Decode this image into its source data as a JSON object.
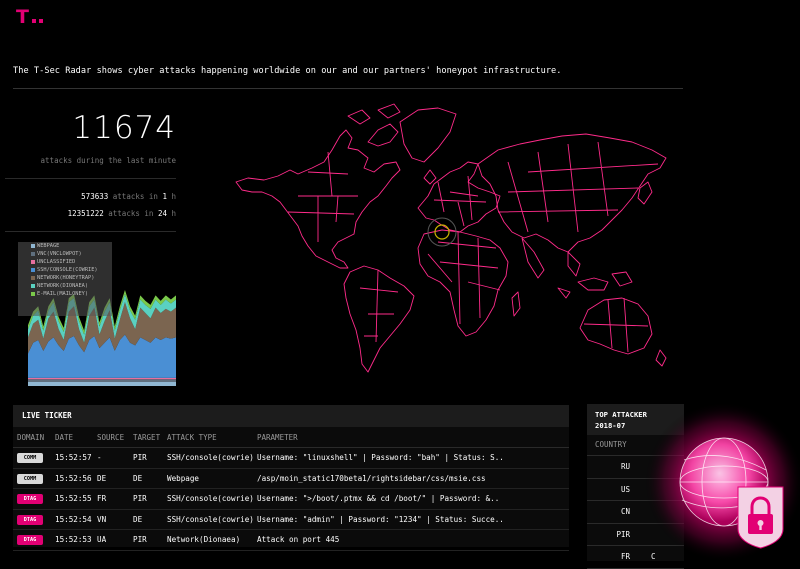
{
  "brand": {
    "logo_letter": "T",
    "color": "#e20074"
  },
  "intro_text": "The T-Sec Radar shows cyber attacks happening worldwide on our and our partners' honeypot infrastructure.",
  "stats": {
    "minute_count": "11674",
    "minute_caption": "attacks during the last minute",
    "hour_count": "573633",
    "hour_mid": "attacks in",
    "hour_value": "1",
    "hour_unit": "h",
    "day_count": "12351222",
    "day_mid": "attacks in",
    "day_value": "24",
    "day_unit": "h"
  },
  "chart_data": {
    "type": "area",
    "stacked": true,
    "series": [
      {
        "name": "WEBPAGE",
        "color": "#8fb6d1",
        "values": [
          3,
          3,
          3,
          3,
          3,
          3,
          3,
          3,
          3,
          3,
          3,
          3,
          3,
          3,
          3,
          3,
          3,
          3,
          3,
          3,
          3,
          3,
          3,
          3,
          3,
          3,
          3,
          3,
          3,
          3
        ]
      },
      {
        "name": "VNC(VNCLOWPOT)",
        "color": "#5f6f7e",
        "values": [
          2,
          2,
          2,
          2,
          2,
          2,
          2,
          2,
          2,
          2,
          2,
          2,
          2,
          2,
          2,
          2,
          2,
          2,
          2,
          2,
          2,
          2,
          2,
          2,
          2,
          2,
          2,
          2,
          2,
          2
        ]
      },
      {
        "name": "UNCLASSIFIED",
        "color": "#e86f9e",
        "values": [
          1,
          1,
          1,
          1,
          1,
          1,
          1,
          1,
          1,
          1,
          1,
          1,
          1,
          1,
          1,
          1,
          1,
          1,
          1,
          1,
          1,
          1,
          1,
          1,
          1,
          1,
          1,
          1,
          1,
          1
        ]
      },
      {
        "name": "SSH/CONSOLE(COWRIE)",
        "color": "#4a8fd4",
        "values": [
          18,
          26,
          28,
          20,
          27,
          30,
          24,
          20,
          29,
          31,
          24,
          19,
          28,
          31,
          22,
          26,
          30,
          20,
          28,
          32,
          26,
          24,
          30,
          28,
          26,
          30,
          28,
          30,
          29,
          30
        ]
      },
      {
        "name": "NETWORK(HONEYTRAP)",
        "color": "#7b6550",
        "values": [
          12,
          14,
          15,
          9,
          17,
          19,
          12,
          8,
          20,
          22,
          12,
          7,
          18,
          21,
          10,
          16,
          20,
          9,
          15,
          24,
          18,
          12,
          22,
          20,
          18,
          22,
          20,
          21,
          20,
          22
        ]
      },
      {
        "name": "NETWORK(DIONAEA)",
        "color": "#5ad1c1",
        "values": [
          6,
          6,
          7,
          6,
          6,
          7,
          6,
          6,
          7,
          6,
          6,
          6,
          7,
          6,
          6,
          7,
          6,
          6,
          7,
          6,
          6,
          7,
          6,
          6,
          7,
          6,
          6,
          7,
          6,
          6
        ]
      },
      {
        "name": "E-MAIL(MAILONEY)",
        "color": "#7ac94a",
        "values": [
          3,
          3,
          3,
          3,
          3,
          3,
          3,
          3,
          3,
          3,
          3,
          3,
          3,
          3,
          3,
          3,
          3,
          3,
          3,
          3,
          3,
          3,
          3,
          3,
          3,
          3,
          3,
          3,
          3,
          3
        ]
      }
    ]
  },
  "ticker": {
    "title": "LIVE TICKER",
    "columns": [
      "DOMAIN",
      "DATE",
      "SOURCE",
      "TARGET",
      "ATTACK TYPE",
      "PARAMETER"
    ],
    "rows": [
      {
        "domain": "COMM",
        "date": "15:52:57",
        "source": "-",
        "target": "PIR",
        "type": "SSH/console(cowrie)",
        "param": "Username: \"linuxshell\" | Password: \"bah\" | Status: S.."
      },
      {
        "domain": "COMM",
        "date": "15:52:56",
        "source": "DE",
        "target": "DE",
        "type": "Webpage",
        "param": "/asp/moin_static170beta1/rightsidebar/css/msie.css"
      },
      {
        "domain": "DTAG",
        "date": "15:52:55",
        "source": "FR",
        "target": "PIR",
        "type": "SSH/console(cowrie)",
        "param": "Username: \">/boot/.ptmx && cd /boot/\" | Password: &.."
      },
      {
        "domain": "DTAG",
        "date": "15:52:54",
        "source": "VN",
        "target": "DE",
        "type": "SSH/console(cowrie)",
        "param": "Username: \"admin\" | Password: \"1234\" | Status: Succe.."
      },
      {
        "domain": "DTAG",
        "date": "15:52:53",
        "source": "UA",
        "target": "PIR",
        "type": "Network(Dionaea)",
        "param": "Attack on port 445"
      }
    ]
  },
  "top_attacker": {
    "title": "TOP ATTACKER",
    "period": "2018-07",
    "column": "COUNTRY",
    "rows": [
      "RU",
      "US",
      "CN",
      "PIR",
      "FR"
    ],
    "fr_trail": "C"
  },
  "colors": {
    "map_line": "#ff2b8a",
    "accent": "#e20074"
  },
  "icons": {
    "map": "world-map",
    "orb": "globe-icon",
    "lock": "lock-icon"
  }
}
